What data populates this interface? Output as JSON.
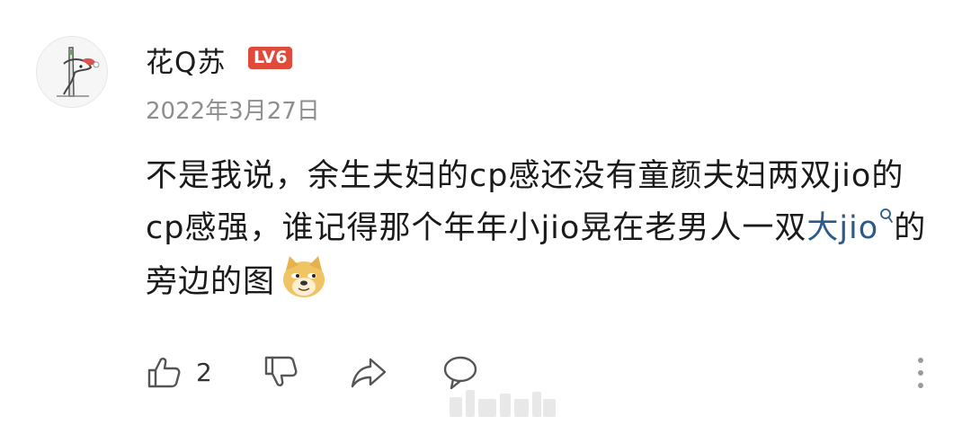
{
  "comment": {
    "username": "花Q苏",
    "level": "LV6",
    "date": "2022年3月27日",
    "text_before_link": "不是我说，余生夫妇的cp感还没有童颜夫妇两双jio的cp感强，谁记得那个年年小jio晃在老男人一双",
    "link_text": "大jio",
    "text_after_link": "的旁边的图",
    "emoji": "doge-emoji"
  },
  "actions": {
    "like_count": "2"
  },
  "colors": {
    "level_badge": "#e04a3b",
    "link": "#2b5b86",
    "date": "#8e8e8e"
  }
}
